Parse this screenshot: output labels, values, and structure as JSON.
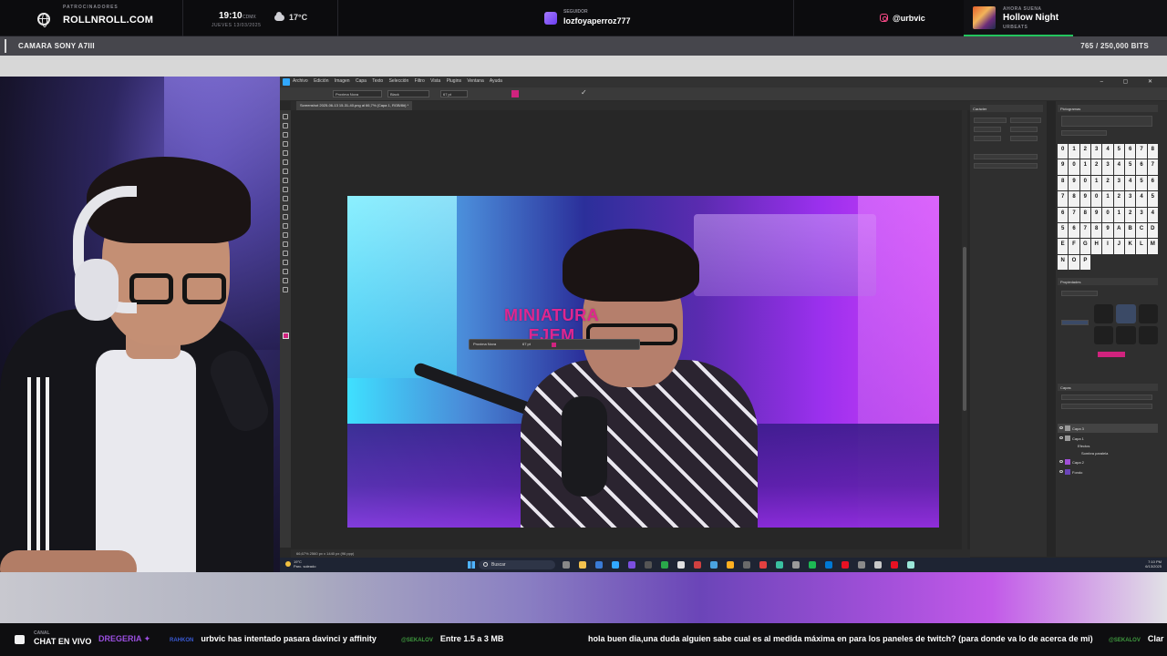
{
  "topbar": {
    "sponsor_kicker": "PATROCINADORES",
    "sponsor_name": "ROLLNROLL.COM",
    "clock_time": "19:10",
    "clock_zone": "CDMX",
    "clock_date": "JUEVES 13/03/2025",
    "weather_temp": "17°C",
    "follower_kicker": "SEGUIDOR",
    "follower_name": "lozfoyaperroz777",
    "instagram_handle": "@urbvic",
    "now_playing_kicker": "AHORA SUENA",
    "now_playing_title": "Hollow Night",
    "now_playing_artist": "URBEATS",
    "now_playing_progress": 0.54
  },
  "camstrip": {
    "label": "CAMARA SONY A7III",
    "bits": "765 / 250,000 BITS"
  },
  "photoshop": {
    "menu": [
      "Archivo",
      "Edición",
      "Imagen",
      "Capa",
      "Texto",
      "Selección",
      "Filtro",
      "Vista",
      "Plugins",
      "Ventana",
      "Ayuda"
    ],
    "window_controls": "– ▢ ✕",
    "options": {
      "font": "Proxima Nova",
      "weight": "Black",
      "size": "67 pt",
      "text_color": "#d0237e",
      "commit": "✓"
    },
    "tab": "Screenshot 2025-06-13 15-31-40.png al 66,7% (Capa 1, RGB/8#) *",
    "status": "66,67%    2560 px x 1440 px (96 ppp)",
    "canvas_text": [
      "MINIATURA",
      "EJEM"
    ],
    "float_bar": {
      "font": "Proxima Nova",
      "size": "67 pt"
    },
    "panels": {
      "character_title": "Carácter",
      "glyphs_title": "Pictogramas",
      "properties_title": "Propiedades",
      "layers_title": "Capas",
      "glyphs": [
        "0",
        "1",
        "2",
        "3",
        "4",
        "5",
        "6",
        "7",
        "8",
        "9",
        "0",
        "1",
        "2",
        "3",
        "4",
        "5",
        "6",
        "7",
        "8",
        "9",
        "0",
        "1",
        "2",
        "3",
        "4",
        "5",
        "6",
        "7",
        "8",
        "9",
        "0",
        "1",
        "2",
        "3",
        "4",
        "5",
        "6",
        "7",
        "8",
        "9",
        "0",
        "1",
        "2",
        "3",
        "4",
        "5",
        "6",
        "7",
        "8",
        "9",
        "A",
        "B",
        "C",
        "D",
        "E",
        "F",
        "G",
        "H",
        "I",
        "J",
        "K",
        "L",
        "M",
        "N",
        "O",
        "P"
      ],
      "layers": [
        "Capa 3",
        "Capa 1",
        "Efectos",
        "Sombra paralela",
        "Capa 2",
        "Fondo"
      ]
    }
  },
  "taskbar": {
    "weather_temp": "19°C",
    "weather_desc": "Parc. soleado",
    "search": "Buscar",
    "time": "7:10 PM",
    "date": "6/13/2025"
  },
  "ticker": {
    "kicker": "CANAL",
    "live_label": "CHAT EN VIVO",
    "messages": [
      {
        "user": "DREGERIA ✦",
        "text": ""
      },
      {
        "user": "RAHKON",
        "text": "urbvic has intentado pasara davinci y affinity"
      },
      {
        "user": "@SEKALOV",
        "text": "Entre 1.5 a 3 MB"
      },
      {
        "user": "",
        "text": "hola buen dia,una duda alguien sabe cual es al medida máxima en para los paneles de twitch? (para donde va lo de acerca de mi)"
      },
      {
        "user": "@SEKALOV",
        "text": "Clar"
      }
    ]
  },
  "colors": {
    "accent_magenta": "#d0237e",
    "progress_green": "#23c55e"
  }
}
